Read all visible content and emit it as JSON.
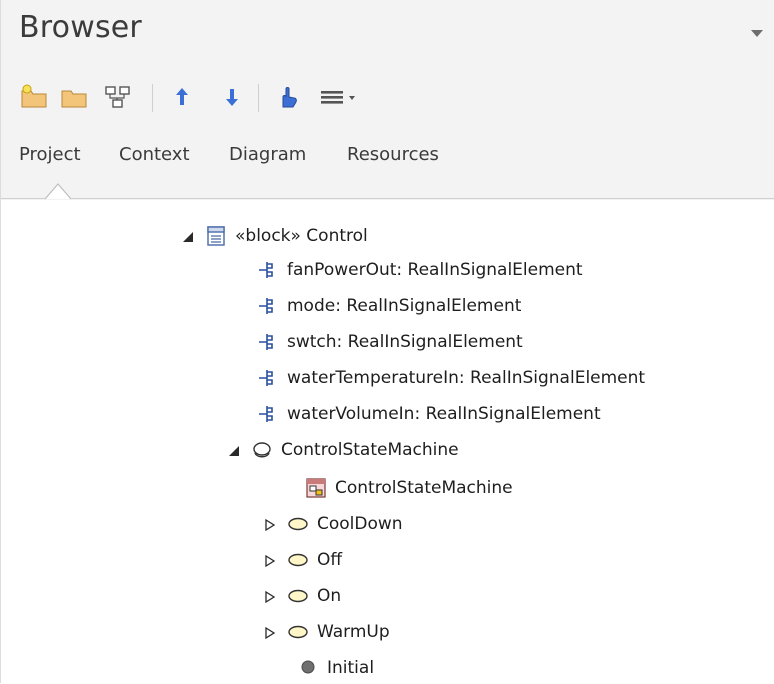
{
  "window": {
    "title": "Browser"
  },
  "toolbar": {
    "icons": [
      "new-package-icon",
      "folder-icon",
      "diagram-icon",
      "move-up-icon",
      "move-down-icon",
      "locate-icon",
      "menu-icon"
    ]
  },
  "tabs": [
    {
      "label": "Project"
    },
    {
      "label": "Context"
    },
    {
      "label": "Diagram"
    },
    {
      "label": "Resources"
    }
  ],
  "tree": {
    "block": {
      "label": "«block» Control"
    },
    "ports": [
      {
        "label": "fanPowerOut: RealInSignalElement"
      },
      {
        "label": "mode: RealInSignalElement"
      },
      {
        "label": "swtch: RealInSignalElement"
      },
      {
        "label": "waterTemperatureIn: RealInSignalElement"
      },
      {
        "label": "waterVolumeIn: RealInSignalElement"
      }
    ],
    "state_machine": {
      "label": "ControlStateMachine"
    },
    "diagram": {
      "label": "ControlStateMachine"
    },
    "states": [
      {
        "label": "CoolDown"
      },
      {
        "label": "Off"
      },
      {
        "label": "On"
      },
      {
        "label": "WarmUp"
      }
    ],
    "initial": {
      "label": "Initial"
    }
  },
  "colors": {
    "panel_bg": "#f3f3f3",
    "accent_blue": "#3b6fd6",
    "port_blue": "#2b4f9e"
  }
}
